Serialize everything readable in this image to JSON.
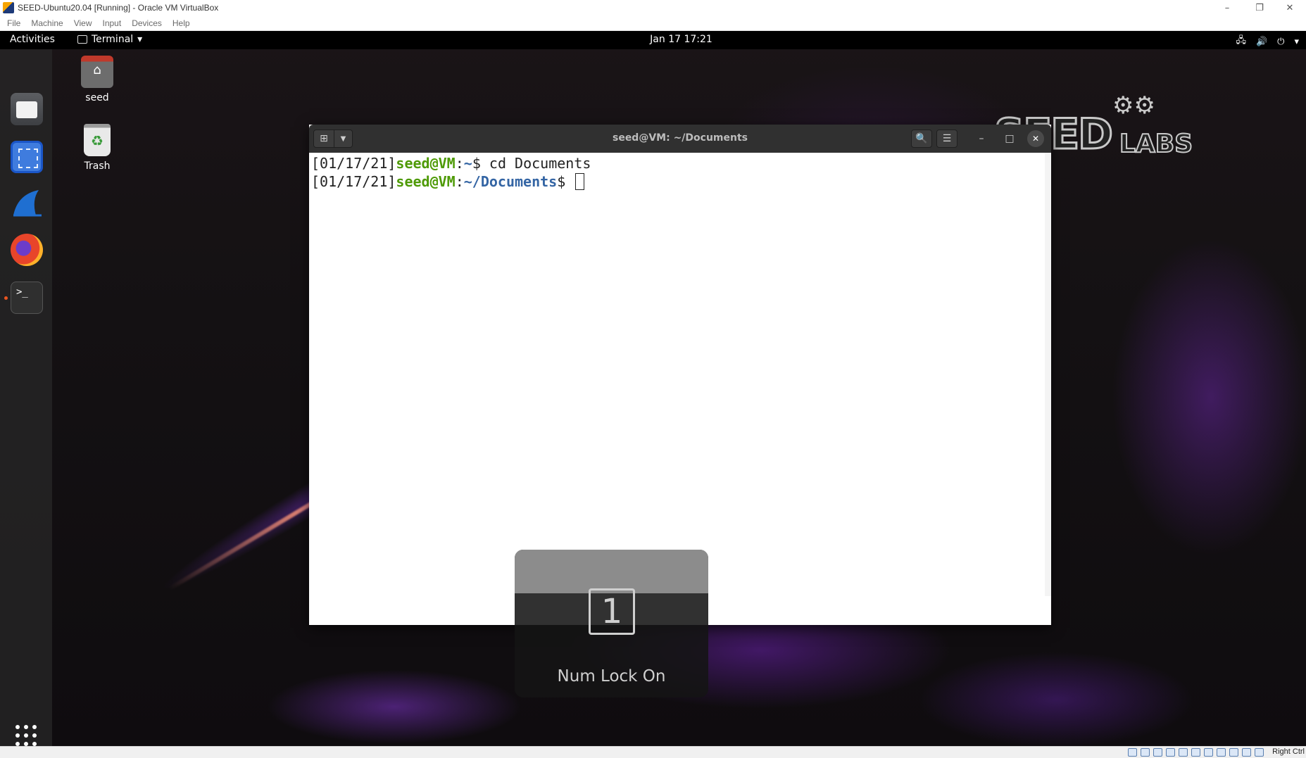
{
  "host": {
    "title": "SEED-Ubuntu20.04 [Running] - Oracle VM VirtualBox",
    "menu": [
      "File",
      "Machine",
      "View",
      "Input",
      "Devices",
      "Help"
    ],
    "controls": {
      "minimize": "–",
      "restore": "❐",
      "close": "✕"
    },
    "host_key": "Right Ctrl"
  },
  "topbar": {
    "activities": "Activities",
    "app_name": "Terminal",
    "app_caret": "▾",
    "clock": "Jan 17  17:21",
    "tray": {
      "network": "🖧",
      "volume": "🔊",
      "power": "⏻",
      "caret": "▾"
    }
  },
  "dock": {
    "items": [
      "files",
      "screenshot",
      "wireshark",
      "firefox",
      "terminal"
    ],
    "terminal_glyph": ">_"
  },
  "desktop": {
    "icons": [
      {
        "label": "seed"
      },
      {
        "label": "Trash"
      }
    ]
  },
  "logo": {
    "seed": "SEED",
    "labs": "LABS",
    "gears": "⚙⚙"
  },
  "terminal": {
    "title": "seed@VM: ~/Documents",
    "header_buttons": {
      "new_tab": "⊞",
      "tab_menu": "▼",
      "search": "🔍",
      "menu": "☰",
      "minimize": "–",
      "maximize": "□",
      "close": "✕"
    },
    "lines": [
      {
        "date": "[01/17/21]",
        "user": "seed@VM",
        "sep": ":",
        "path": "~",
        "prompt": "$ ",
        "cmd": "cd Documents"
      },
      {
        "date": "[01/17/21]",
        "user": "seed@VM",
        "sep": ":",
        "path": "~/Documents",
        "prompt": "$ ",
        "cmd": ""
      }
    ]
  },
  "osd": {
    "key": "1",
    "label": "Num Lock On"
  },
  "colors": {
    "prompt_user": "#4e9a06",
    "prompt_path": "#3465a4",
    "accent_wallpaper": "#8a3cf0"
  }
}
